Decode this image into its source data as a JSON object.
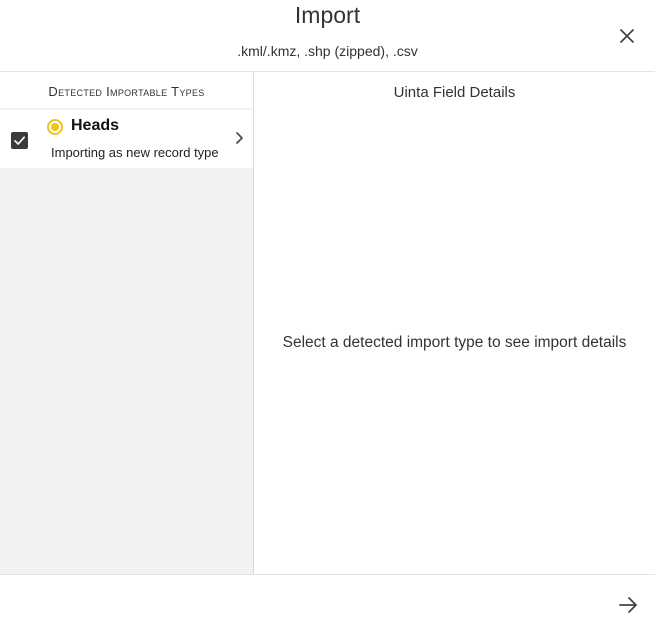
{
  "header": {
    "title": "Import",
    "subtitle": ".kml/.kmz, .shp (zipped), .csv",
    "close_icon": "close-icon"
  },
  "left_pane": {
    "heading": "Detected Importable Types",
    "items": [
      {
        "name": "Heads",
        "description": "Importing as new record type",
        "checked": true,
        "status_color": "#f0c419",
        "icons": [
          "checkbox-checked-icon",
          "status-dot-icon",
          "chevron-right-icon"
        ]
      }
    ]
  },
  "right_pane": {
    "title": "Uinta Field Details",
    "hint": "Select a detected import type to see import details"
  },
  "footer": {
    "next_icon": "arrow-right-icon"
  },
  "colors": {
    "accent_yellow": "#f0c419",
    "panel_gray": "#f2f2f2",
    "checkbox_fill": "#3b3b3b"
  }
}
